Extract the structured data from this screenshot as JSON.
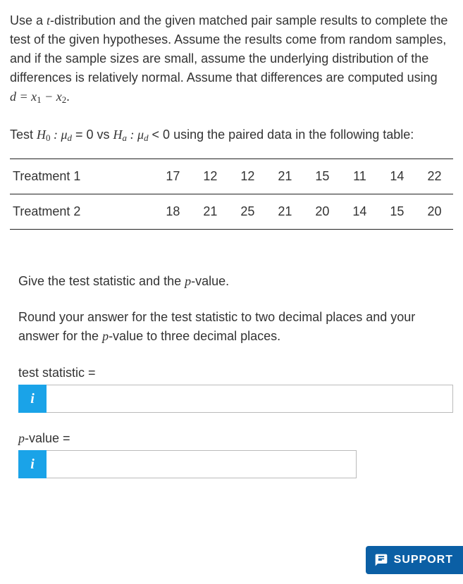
{
  "intro": {
    "part1": "Use a ",
    "t_text": "t",
    "part2": "-distribution and the given matched pair sample results to complete the test of the given hypotheses. Assume the results come from random samples, and if the sample sizes are small, assume the underlying distribution of the differences is relatively normal. Assume that differences are computed using "
  },
  "hypothesis": {
    "prefix": "Test ",
    "eqzero": " = 0 vs ",
    "ltzero": " < 0 using the paired data in the following table:"
  },
  "table": {
    "rows": [
      {
        "label": "Treatment 1",
        "values": [
          "17",
          "12",
          "12",
          "21",
          "15",
          "11",
          "14",
          "22"
        ]
      },
      {
        "label": "Treatment 2",
        "values": [
          "18",
          "21",
          "25",
          "21",
          "20",
          "14",
          "15",
          "20"
        ]
      }
    ]
  },
  "prompt": {
    "part1": "Give the test statistic and the ",
    "pword": "p",
    "part2": "-value."
  },
  "round_note": {
    "part1": "Round your answer for the test statistic to two decimal places and your answer for the ",
    "pword": "p",
    "part2": "-value to three decimal places."
  },
  "fields": {
    "test_stat_label": "test statistic = ",
    "pvalue_label_p": "p",
    "pvalue_label_rest": "-value = ",
    "info_symbol": "i"
  },
  "support": {
    "label": "SUPPORT"
  }
}
